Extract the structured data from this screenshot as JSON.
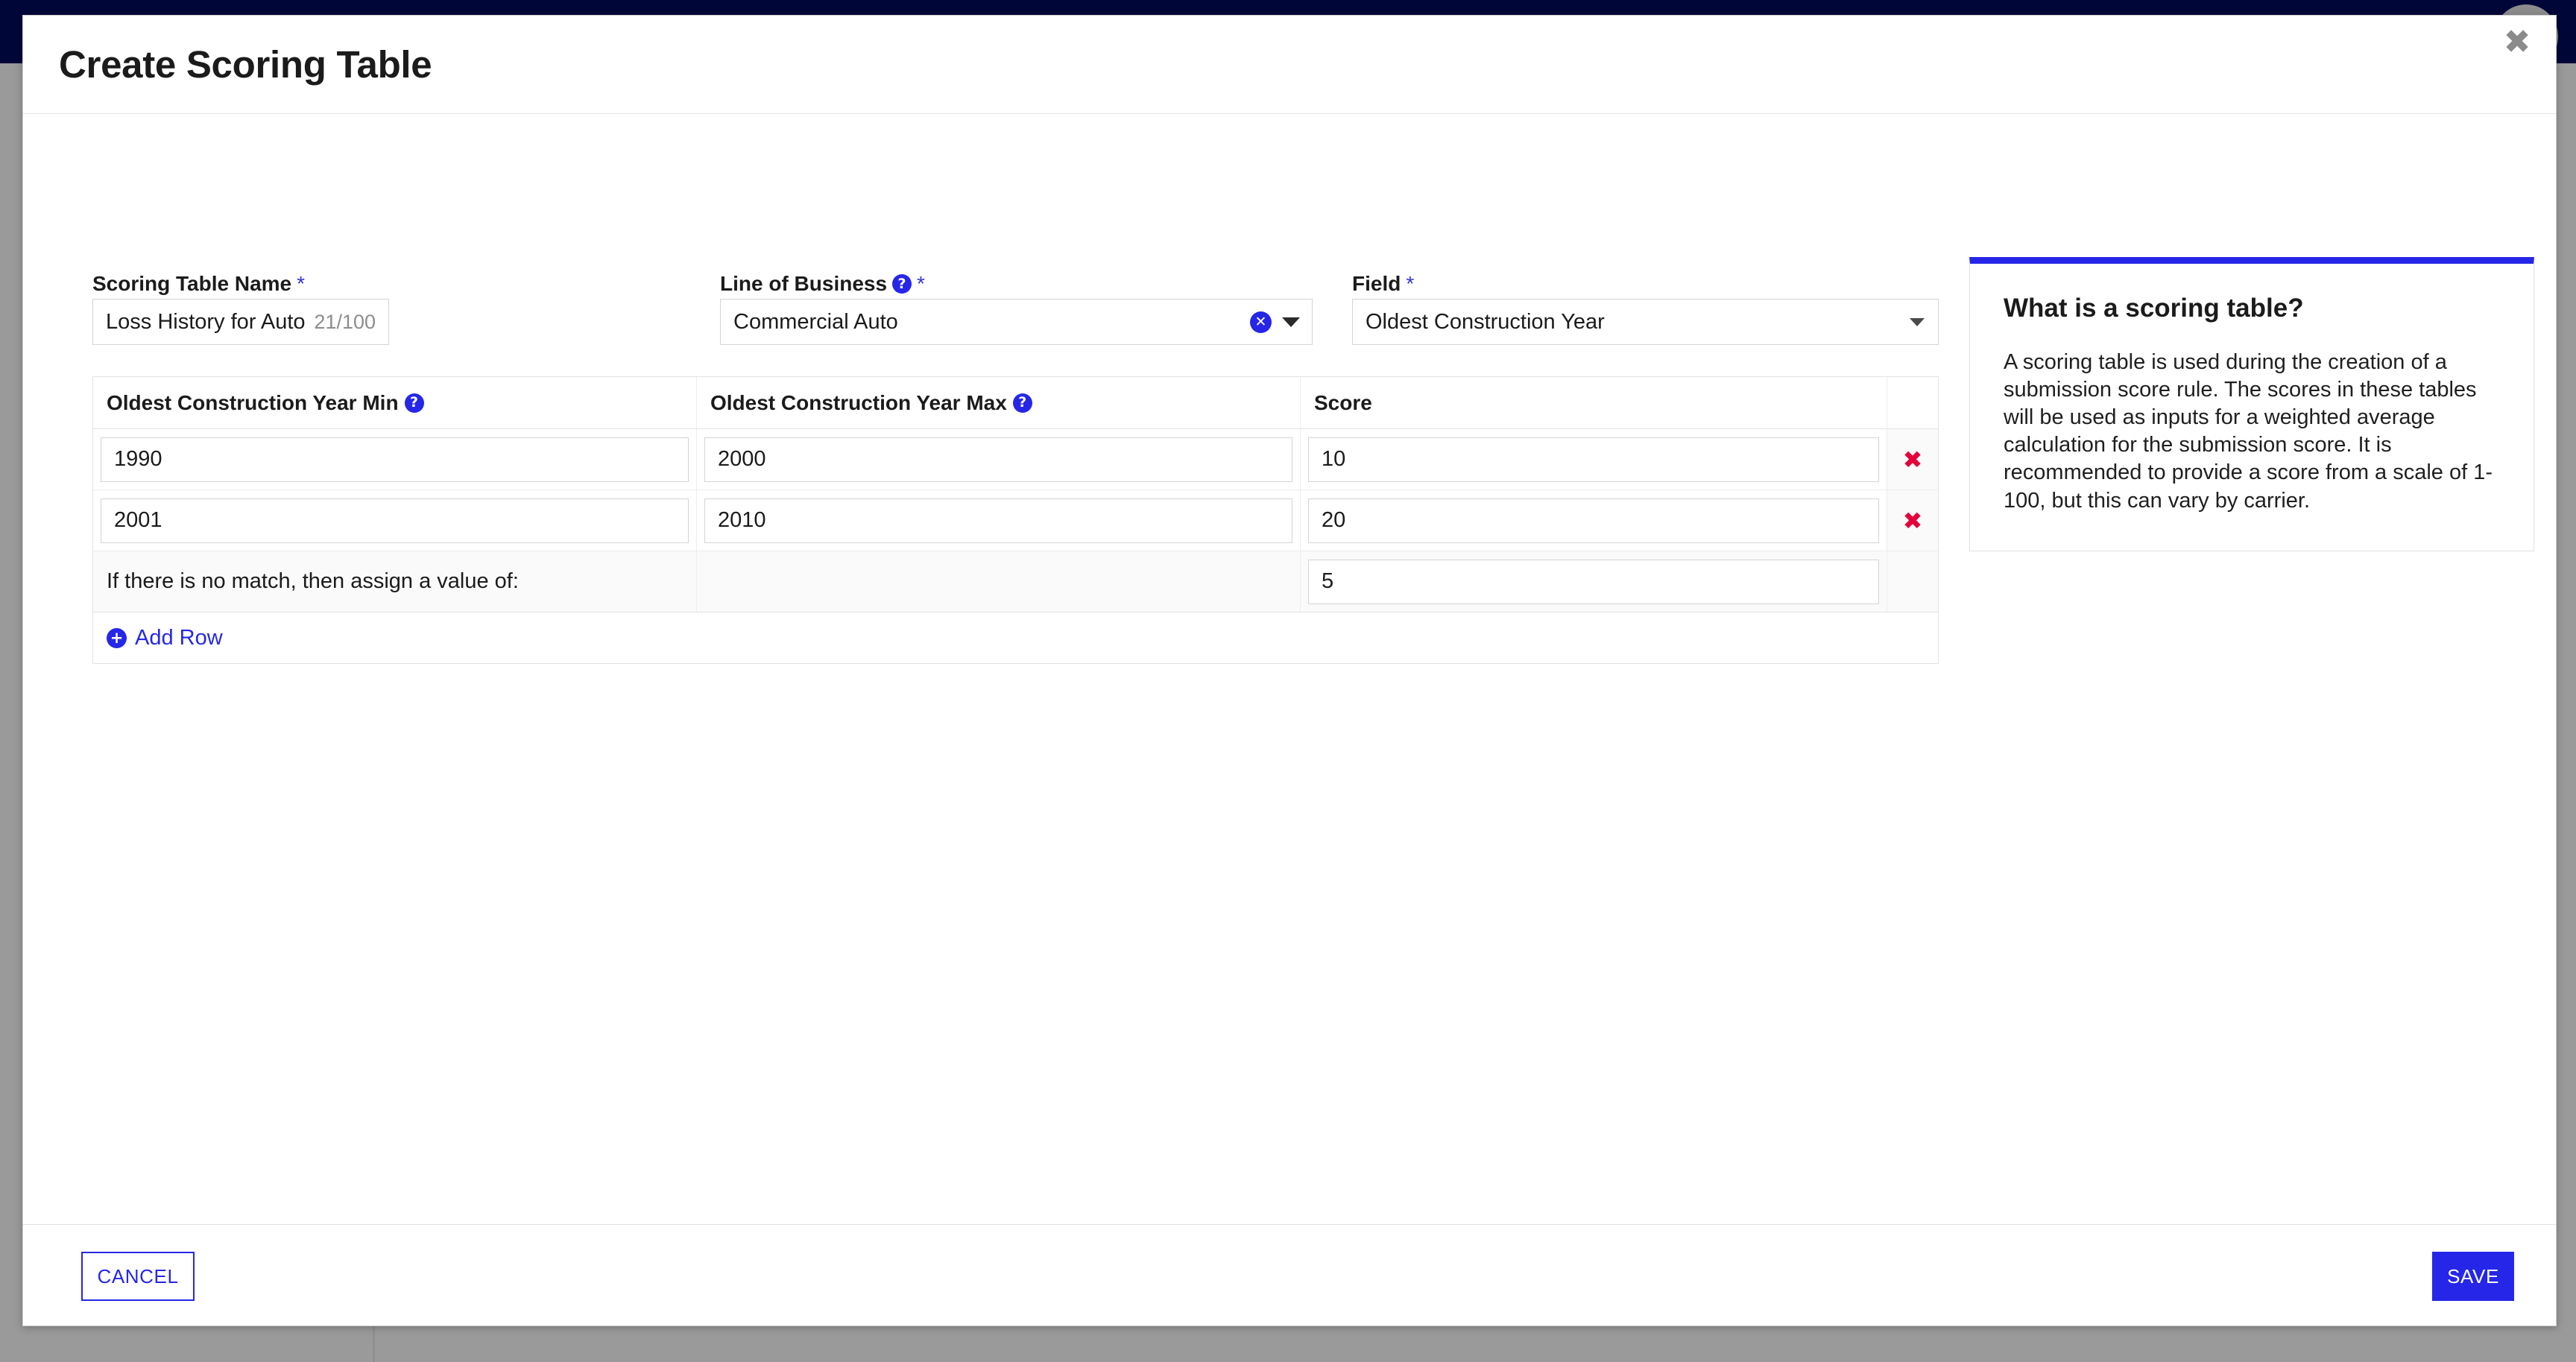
{
  "modal": {
    "title": "Create Scoring Table",
    "close_label": "✖"
  },
  "form": {
    "name": {
      "label": "Scoring Table Name",
      "required_marker": "*",
      "value": "Loss History for Auto",
      "char_count": "21/100"
    },
    "line_of_business": {
      "label": "Line of Business",
      "help_glyph": "?",
      "required_marker": "*",
      "value": "Commercial Auto",
      "clear_glyph": "✕"
    },
    "field": {
      "label": "Field",
      "required_marker": "*",
      "value": "Oldest Construction Year"
    }
  },
  "table": {
    "columns": [
      {
        "label": "Oldest Construction Year Min",
        "help_glyph": "?"
      },
      {
        "label": "Oldest Construction Year Max",
        "help_glyph": "?"
      },
      {
        "label": "Score",
        "help_glyph": ""
      },
      {
        "label": "",
        "help_glyph": ""
      }
    ],
    "rows": [
      {
        "min": "1990",
        "max": "2000",
        "score": "10",
        "delete_glyph": "✖"
      },
      {
        "min": "2001",
        "max": "2010",
        "score": "20",
        "delete_glyph": "✖"
      }
    ],
    "no_match": {
      "label": "If there is no match, then assign a value of:",
      "score": "5"
    },
    "add_row": {
      "label": "Add Row",
      "plus_glyph": "+"
    }
  },
  "info_panel": {
    "title": "What is a scoring table?",
    "body": "A scoring table is used during the creation of a submission score rule. The scores in these tables will be used as inputs for a weighted average calculation for the submission score. It is recommended to provide a score from a scale of 1-100, but this can vary by carrier.",
    "accent_color": "#2626e8"
  },
  "footer": {
    "cancel_label": "CANCEL",
    "save_label": "SAVE"
  }
}
